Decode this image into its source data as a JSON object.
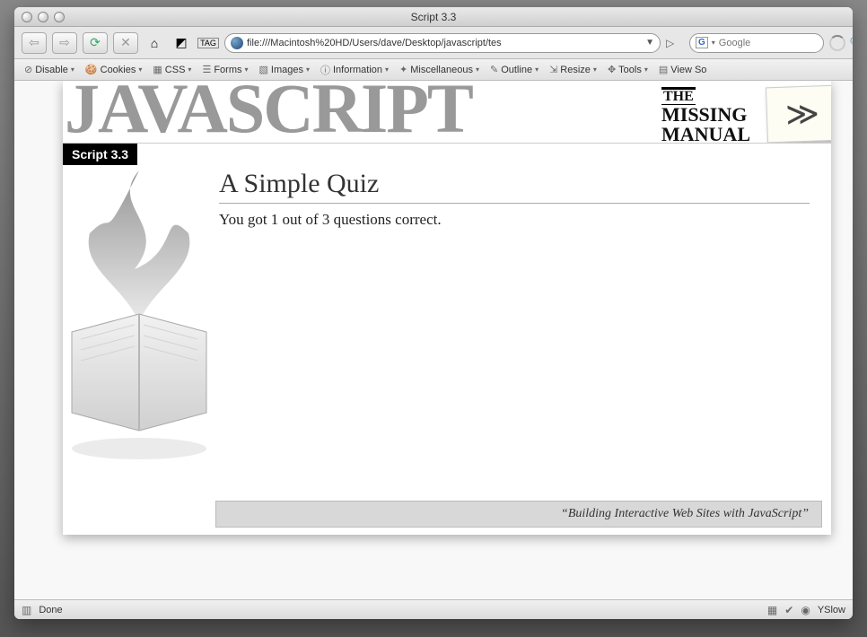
{
  "window": {
    "title": "Script 3.3"
  },
  "nav": {
    "url": "file:///Macintosh%20HD/Users/dave/Desktop/javascript/tes",
    "search_placeholder": "Google"
  },
  "devbar": {
    "items": [
      {
        "icon": "⊘",
        "label": "Disable"
      },
      {
        "icon": "🍪",
        "label": "Cookies"
      },
      {
        "icon": "▦",
        "label": "CSS"
      },
      {
        "icon": "☰",
        "label": "Forms"
      },
      {
        "icon": "▧",
        "label": "Images"
      },
      {
        "icon": "ⓘ",
        "label": "Information"
      },
      {
        "icon": "✦",
        "label": "Miscellaneous"
      },
      {
        "icon": "✎",
        "label": "Outline"
      },
      {
        "icon": "⇲",
        "label": "Resize"
      },
      {
        "icon": "✥",
        "label": "Tools"
      },
      {
        "icon": "▤",
        "label": "View So"
      }
    ]
  },
  "page": {
    "banner_word": "JAVASCRIPT",
    "missing_the": "THE",
    "missing_line1": "MISSING",
    "missing_line2": "MANUAL",
    "sticky": "≫",
    "script_tag": "Script 3.3",
    "heading": "A Simple Quiz",
    "result": "You got 1 out of 3 questions correct.",
    "footer": "“Building Interactive Web Sites with JavaScript”"
  },
  "status": {
    "text": "Done",
    "yslow": "YSlow"
  }
}
